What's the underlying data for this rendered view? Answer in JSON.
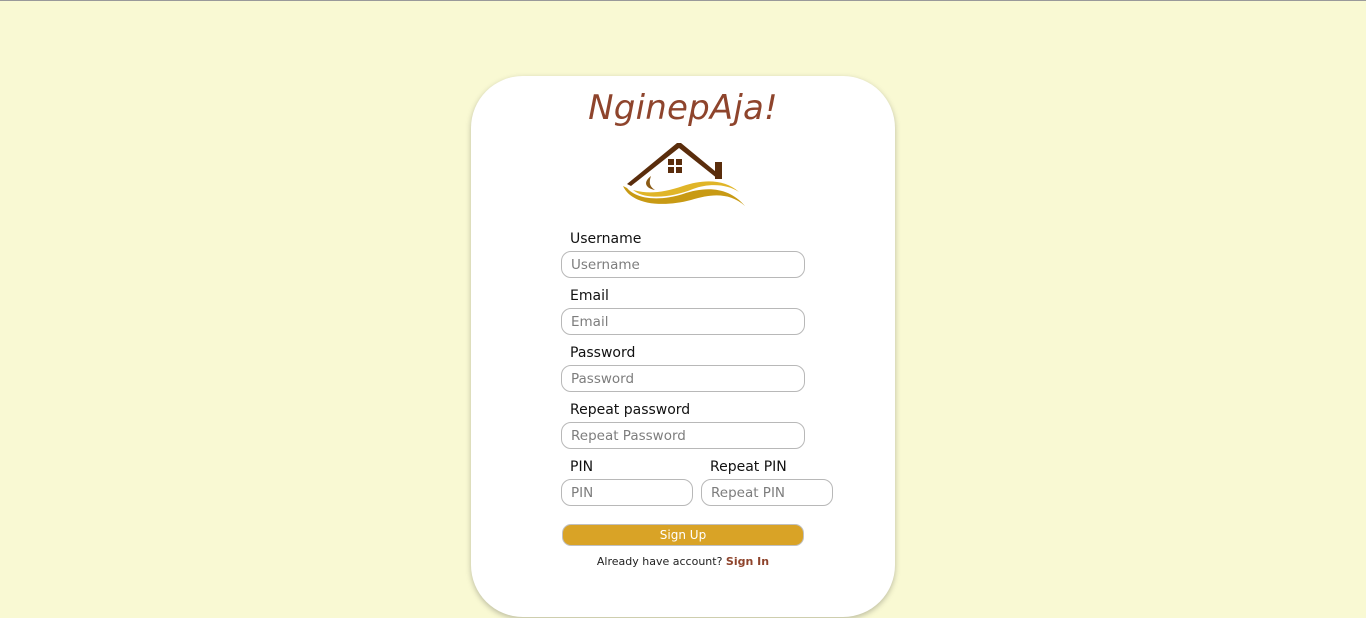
{
  "app": {
    "brand": "NginepAja!",
    "logo_icon": "house-logo-icon"
  },
  "form": {
    "username": {
      "label": "Username",
      "placeholder": "Username",
      "value": ""
    },
    "email": {
      "label": "Email",
      "placeholder": "Email",
      "value": ""
    },
    "password": {
      "label": "Password",
      "placeholder": "Password",
      "value": ""
    },
    "repeat_password": {
      "label": "Repeat password",
      "placeholder": "Repeat Password",
      "value": ""
    },
    "pin": {
      "label": "PIN",
      "placeholder": "PIN",
      "value": ""
    },
    "repeat_pin": {
      "label": "Repeat PIN",
      "placeholder": "Repeat PIN",
      "value": ""
    },
    "submit_label": "Sign Up"
  },
  "footer": {
    "prompt": "Already have account?",
    "link_label": "Sign In"
  },
  "colors": {
    "background": "#f9f9d3",
    "brand": "#8e442c",
    "button": "#d9a326"
  }
}
